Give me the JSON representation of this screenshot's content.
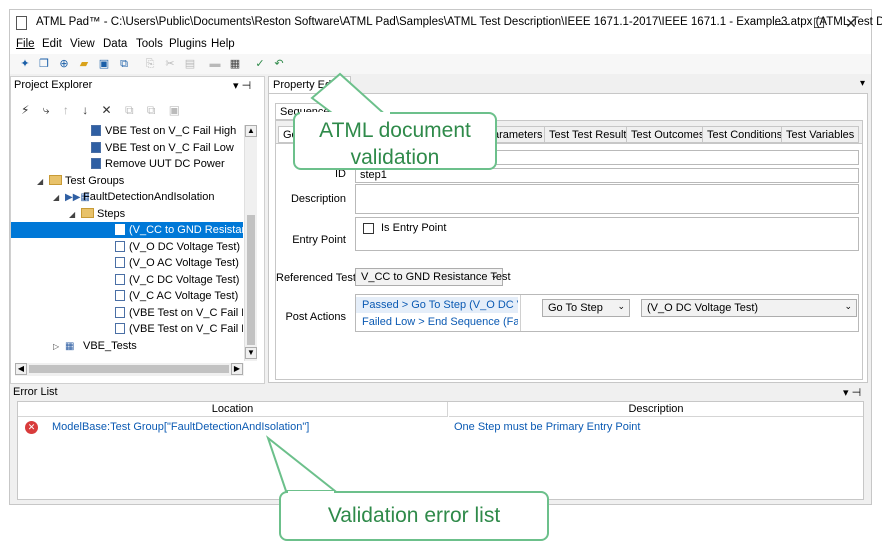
{
  "window": {
    "title": "ATML Pad™ - C:\\Users\\Public\\Documents\\Reston Software\\ATML Pad\\Samples\\ATML Test Description\\IEEE 1671.1-2017\\IEEE 1671.1 - Example3.atpx (ATML Test Desc...",
    "minimize": "—",
    "maximize": "☐",
    "close": "✕"
  },
  "menu": [
    "File",
    "Edit",
    "View",
    "Data",
    "Tools",
    "Plugins",
    "Help"
  ],
  "project_explorer": {
    "title": "Project Explorer",
    "pin": "▾  ⊣",
    "rows": [
      {
        "label": "VBE Test on V_C Fail High",
        "indent": 80
      },
      {
        "label": "VBE Test on V_C Fail Low",
        "indent": 80
      },
      {
        "label": "Remove UUT DC Power",
        "indent": 80
      },
      {
        "label": "Test Groups",
        "indent": 40
      },
      {
        "label": "FaultDetectionAndIsolation",
        "indent": 56
      },
      {
        "label": "Steps",
        "indent": 72
      },
      {
        "label": "(V_CC to GND Resistance",
        "indent": 104
      },
      {
        "label": "(V_O DC Voltage Test)",
        "indent": 104
      },
      {
        "label": "(V_O AC Voltage Test)",
        "indent": 104
      },
      {
        "label": "(V_C DC Voltage Test)",
        "indent": 104
      },
      {
        "label": "(V_C AC Voltage Test)",
        "indent": 104
      },
      {
        "label": "(VBE Test on V_C Fail High",
        "indent": 104
      },
      {
        "label": "(VBE Test on V_C Fail Low)",
        "indent": 104
      },
      {
        "label": "VBE_Tests",
        "indent": 56
      }
    ]
  },
  "property_editor": {
    "tab": "Property Editor",
    "sequence_tab": "Sequence",
    "inner_tabs": [
      "Ge",
      "arameters",
      "Test Test Results",
      "Test Outcomes",
      "Test Conditions",
      "Test Variables"
    ],
    "id_label": "ID",
    "id_value": "step1",
    "description_label": "Description",
    "entry_point_label": "Entry Point",
    "entry_point_checkbox": "Is Entry Point",
    "referenced_test_label": "Referenced Test",
    "referenced_test_value": "V_CC to GND Resistance Test",
    "post_actions_label": "Post Actions",
    "post_actions": [
      "Passed > Go To Step (V_O DC Volt",
      "Failed Low > End Sequence (Failec"
    ],
    "action_combo": "Go To Step",
    "target_combo": "(V_O DC Voltage Test)"
  },
  "error_list": {
    "title": "Error List",
    "columns": [
      "Location",
      "Description"
    ],
    "rows": [
      {
        "location": "ModelBase:Test Group[\"FaultDetectionAndIsolation\"]",
        "description": "One Step must be Primary Entry Point"
      }
    ]
  },
  "callouts": {
    "atml": "ATML document validation",
    "validation": "Validation error list"
  },
  "colors": {
    "accent": "#0b5ab3",
    "selection": "#0078d7",
    "callout": "#6cc08b",
    "error": "#d83b3b"
  }
}
